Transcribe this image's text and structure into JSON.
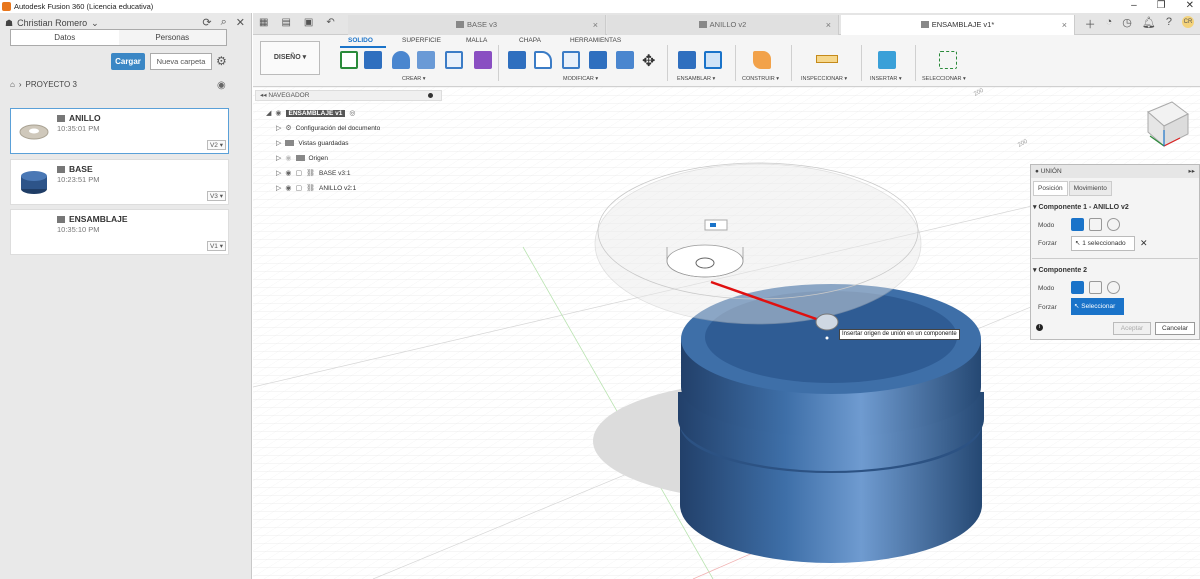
{
  "window": {
    "title": "Autodesk Fusion 360 (Licencia educativa)",
    "min": "–",
    "max": "❐",
    "close": "✕"
  },
  "left": {
    "user": "Christian Romero",
    "tabs": [
      "Datos",
      "Personas"
    ],
    "cargar": "Cargar",
    "nueva_carpeta": "Nueva carpeta",
    "breadcrumb": "PROYECTO 3",
    "files": [
      {
        "name": "ANILLO",
        "time": "10:35:01 PM",
        "version": "V2 ▾"
      },
      {
        "name": "BASE",
        "time": "10:23:51 PM",
        "version": "V3 ▾"
      },
      {
        "name": "ENSAMBLAJE",
        "time": "10:35:10 PM",
        "version": "V1 ▾"
      }
    ]
  },
  "doc_tabs": [
    {
      "label": "BASE v3",
      "close": "×"
    },
    {
      "label": "ANILLO v2",
      "close": "×"
    },
    {
      "label": "ENSAMBLAJE v1*",
      "close": "×"
    }
  ],
  "toolbar": {
    "workspace": "DISEÑO ▾",
    "ribbon_tabs": [
      "SOLIDO",
      "SUPERFICIE",
      "MALLA",
      "CHAPA",
      "HERRAMIENTAS"
    ],
    "groups": [
      "CREAR ▾",
      "MODIFICAR ▾",
      "ENSAMBLAR ▾",
      "CONSTRUIR ▾",
      "INSPECCIONAR ▾",
      "INSERTAR ▾",
      "SELECCIONAR ▾"
    ]
  },
  "navigator": {
    "title": "NAVEGADOR",
    "root": "ENSAMBLAJE v1",
    "items": [
      "Configuración del documento",
      "Vistas guardadas",
      "Origen",
      "BASE v3:1",
      "ANILLO v2:1"
    ]
  },
  "viewport": {
    "grid_label_1": "200",
    "grid_label_2": "200",
    "tooltip": "Insertar origen de unión en un componente"
  },
  "union": {
    "title": "UNIÓN",
    "tabs": [
      "Posición",
      "Movimiento"
    ],
    "comp1_header": "▾ Componente 1 - ANILLO v2",
    "comp2_header": "▾ Componente 2",
    "modo": "Modo",
    "forzar": "Forzar",
    "selected1": "1 seleccionado",
    "seleccionar": "Seleccionar",
    "aceptar": "Aceptar",
    "cancelar": "Cancelar"
  },
  "colors": {
    "accent": "#1a73c9",
    "part_blue": "#3e6fa8"
  }
}
